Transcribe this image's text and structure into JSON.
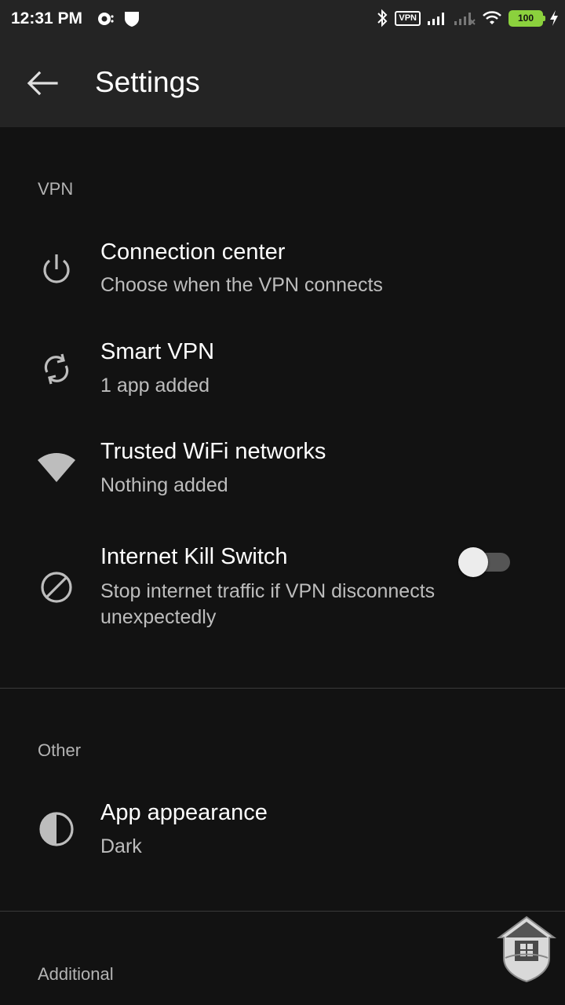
{
  "status_bar": {
    "time": "12:31 PM",
    "vpn_badge": "VPN",
    "battery_level": "100"
  },
  "app_bar": {
    "title": "Settings",
    "back_icon": "arrow-left-icon"
  },
  "sections": {
    "vpn": {
      "header": "VPN",
      "items": [
        {
          "title": "Connection center",
          "subtitle": "Choose when the VPN connects",
          "icon": "power-icon"
        },
        {
          "title": "Smart VPN",
          "subtitle": "1 app added",
          "icon": "sync-icon"
        },
        {
          "title": "Trusted WiFi networks",
          "subtitle": "Nothing added",
          "icon": "wifi-icon"
        },
        {
          "title": "Internet Kill Switch",
          "subtitle": "Stop internet traffic if VPN disconnects unexpectedly",
          "icon": "block-icon",
          "toggle_on": false
        }
      ]
    },
    "other": {
      "header": "Other",
      "items": [
        {
          "title": "App appearance",
          "subtitle": "Dark",
          "icon": "contrast-icon"
        }
      ]
    },
    "additional": {
      "header": "Additional"
    }
  },
  "colors": {
    "background": "#121212",
    "app_bar": "#242424",
    "secondary_text": "#bdbdbd",
    "battery": "#8bd13d"
  }
}
